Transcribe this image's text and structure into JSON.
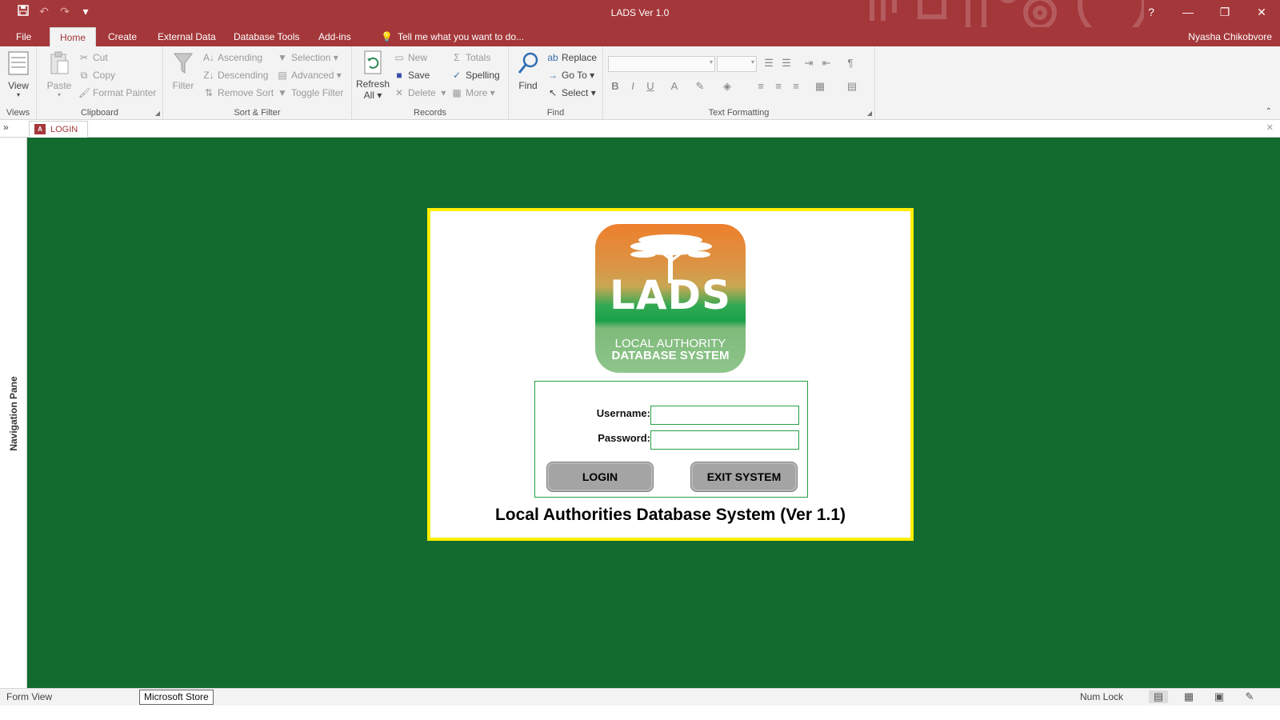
{
  "window": {
    "title": "LADS Ver 1.0",
    "user": "Nyasha Chikobvore",
    "help_icon": "?",
    "minimize_icon": "—",
    "restore_icon": "❐",
    "close_icon": "✕"
  },
  "qat": {
    "save_icon": "💾",
    "undo_icon": "↶",
    "redo_icon": "↷",
    "customize_icon": "▾"
  },
  "tabs": [
    {
      "label": "File"
    },
    {
      "label": "Home"
    },
    {
      "label": "Create"
    },
    {
      "label": "External Data"
    },
    {
      "label": "Database Tools"
    },
    {
      "label": "Add-ins"
    }
  ],
  "tellme": "Tell me what you want to do...",
  "ribbon": {
    "views": {
      "label": "Views",
      "view": "View"
    },
    "clipboard": {
      "label": "Clipboard",
      "paste": "Paste",
      "cut": "Cut",
      "copy": "Copy",
      "format_painter": "Format Painter"
    },
    "sort_filter": {
      "label": "Sort & Filter",
      "filter": "Filter",
      "ascending": "Ascending",
      "descending": "Descending",
      "remove_sort": "Remove Sort",
      "selection": "Selection",
      "advanced": "Advanced",
      "toggle_filter": "Toggle Filter"
    },
    "records": {
      "label": "Records",
      "refresh": "Refresh",
      "refresh_all": "All",
      "new": "New",
      "save": "Save",
      "delete": "Delete",
      "totals": "Totals",
      "spelling": "Spelling",
      "more": "More"
    },
    "find": {
      "label": "Find",
      "find": "Find",
      "replace": "Replace",
      "goto": "Go To",
      "select": "Select"
    },
    "text_formatting": {
      "label": "Text Formatting",
      "bold": "B",
      "italic": "I",
      "underline": "U"
    }
  },
  "object_tab": {
    "label": "LOGIN",
    "icon": "A"
  },
  "nav_pane": {
    "label": "Navigation Pane"
  },
  "login": {
    "logo_text": "LADS",
    "logo_sub1": "LOCAL AUTHORITY",
    "logo_sub2": "DATABASE SYSTEM",
    "username_label": "Username:",
    "password_label": "Password:",
    "username_value": "",
    "password_value": "",
    "login_button": "LOGIN",
    "exit_button": "EXIT SYSTEM",
    "caption": "Local Authorities Database System (Ver 1.1)",
    "colors": {
      "background": "#136b30",
      "frame": "#ffee00",
      "border": "#27a047"
    }
  },
  "status": {
    "mode": "Form View",
    "tooltip": "Microsoft Store",
    "numlock": "Num Lock"
  }
}
